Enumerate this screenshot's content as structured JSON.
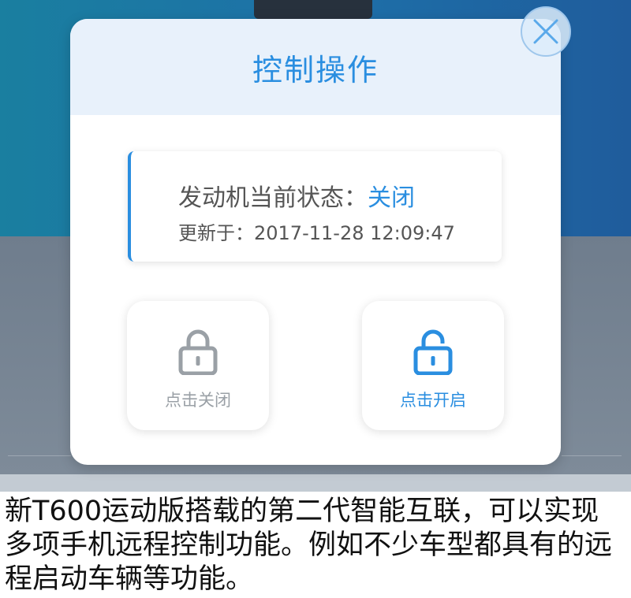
{
  "dialog": {
    "title": "控制操作",
    "close_icon": "close-icon"
  },
  "status": {
    "label": "发动机当前状态：",
    "value": "关闭",
    "updated_label": "更新于：",
    "updated_time": "2017-11-28 12:09:47"
  },
  "actions": {
    "lock": {
      "label": "点击关闭",
      "icon": "lock-icon",
      "color": "#9aa0a6"
    },
    "unlock": {
      "label": "点击开启",
      "icon": "unlock-icon",
      "color": "#2a8ee0"
    }
  },
  "caption": {
    "text": "新T600运动版搭载的第二代智能互联，可以实现多项手机远程控制功能。例如不少车型都具有的远程启动车辆等功能。"
  },
  "colors": {
    "accent": "#2a8ee0",
    "header_bg": "#e8f1fb"
  }
}
